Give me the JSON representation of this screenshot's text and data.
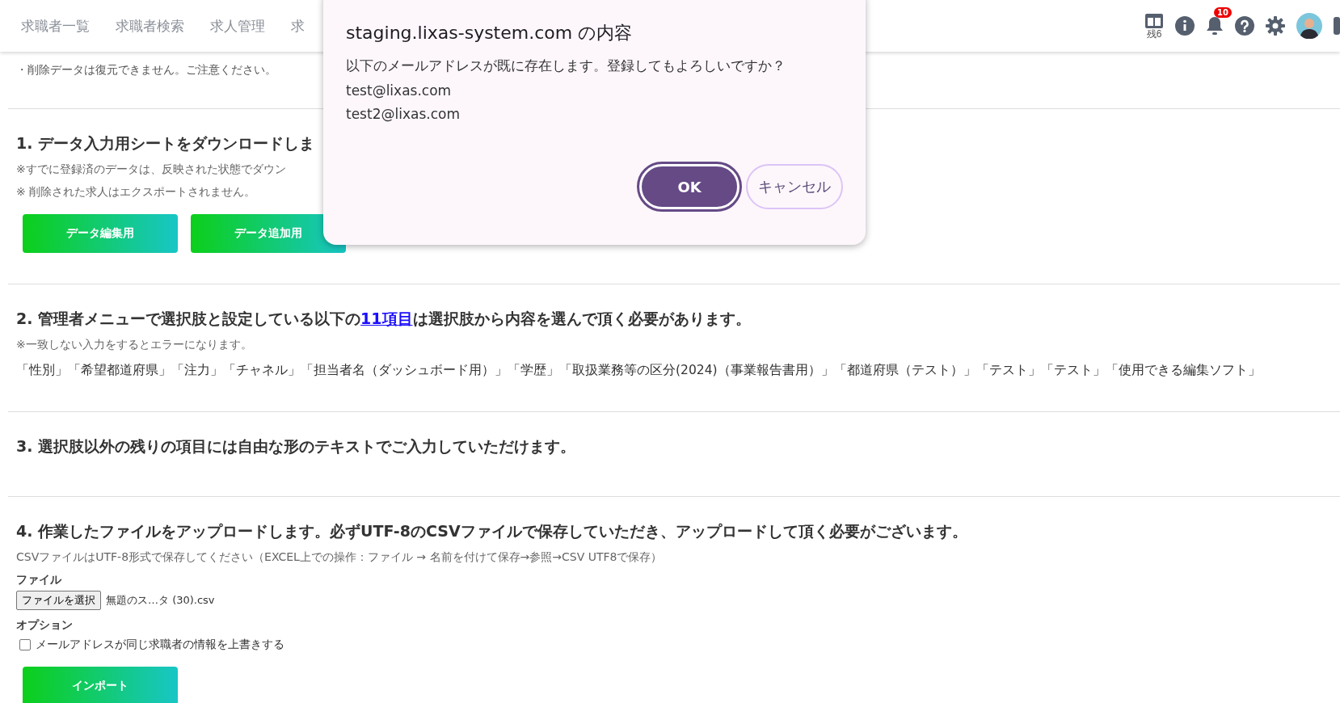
{
  "nav": {
    "tabs": [
      {
        "label": "求職者一覧",
        "selected": false
      },
      {
        "label": "求職者検索",
        "selected": false
      },
      {
        "label": "求人管理",
        "selected": false
      },
      {
        "label": "求",
        "selected": false
      }
    ],
    "remaining": "残6",
    "notification_count": "10"
  },
  "notice": "・削除データは復元できません。ご注意ください。",
  "sections": [
    {
      "kind": "download",
      "heading": "1. データ入力用シートをダウンロードしま",
      "notes": [
        "※すでに登録済のデータは、反映された状態でダウン",
        "※ 削除された求人はエクスポートされません。"
      ],
      "buttons": [
        "データ編集用",
        "データ追加用"
      ]
    },
    {
      "kind": "choices",
      "heading_before": "2. 管理者メニューで選択肢と設定している以下の",
      "heading_link": "11項目",
      "heading_after": "は選択肢から内容を選んで頂く必要があります。",
      "notes": [
        "※一致しない入力をするとエラーになります。"
      ],
      "items": "「性別」「希望都道府県」「注力」「チャネル」「担当者名（ダッシュボード用）」「学歴」「取扱業務等の区分(2024)（事業報告書用）」「都道府県（テスト）」「テスト」「テスト」「使用できる編集ソフト」"
    },
    {
      "kind": "text",
      "heading": "3. 選択肢以外の残りの項目には自由な形のテキストでご入力していただけます。"
    },
    {
      "kind": "upload",
      "heading": "4. 作業したファイルをアップロードします。必ずUTF-8のCSVファイルで保存していただき、アップロードして頂く必要がございます。",
      "notes": [
        "CSVファイルはUTF-8形式で保存してください（EXCEL上での操作：ファイル → 名前を付けて保存→参照→CSV UTF8で保存）"
      ],
      "file_label": "ファイル",
      "file_button": "ファイルを選択",
      "file_name": "無題のス…タ (30).csv",
      "option_label": "オプション",
      "option": {
        "label": "メールアドレスが同じ求職者の情報を上書きする",
        "checked": false
      },
      "submit": "インポート"
    }
  ],
  "dialog": {
    "title": "staging.lixas-system.com の内容",
    "message": "以下のメールアドレスが既に存在します。登録してもよろしいですか？",
    "emails": [
      "test@lixas.com",
      "test2@lixas.com"
    ],
    "ok": "OK",
    "cancel": "キャンセル"
  }
}
